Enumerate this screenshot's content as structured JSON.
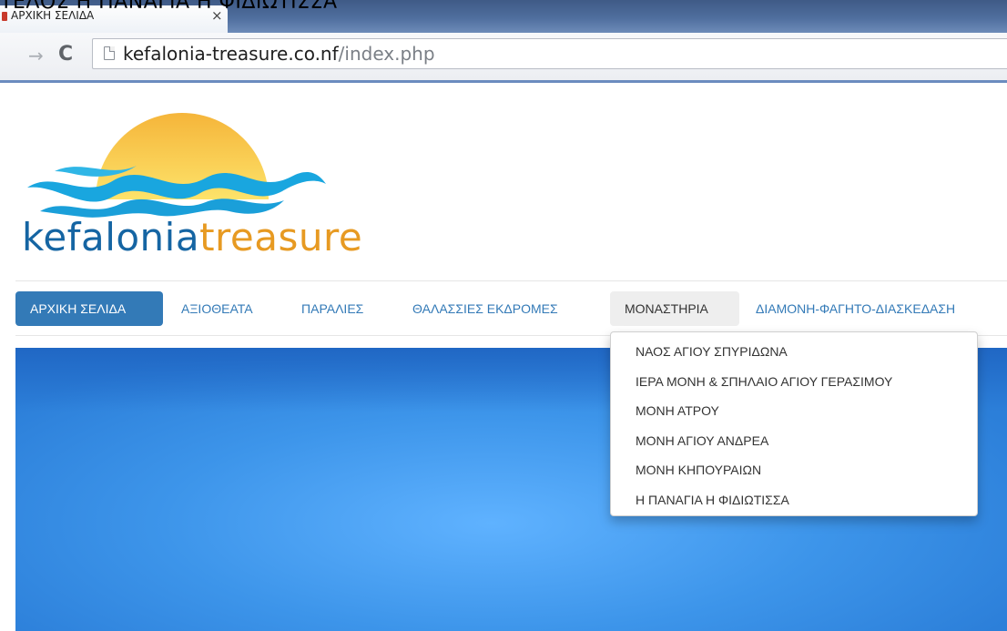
{
  "browser": {
    "stray_text": "ΤΕΛΟΣ Η ΠΑΝΑΓΙΑ Η ΦΙΔΙΩΤΙΣΣΑ",
    "tab_title": "ΑΡΧΙΚΗ ΣΕΛΙΔΑ",
    "tab_close_glyph": "×",
    "forward_glyph": "→",
    "reload_glyph": "C",
    "url_host": "kefalonia-treasure.co.nf",
    "url_path": "/index.php",
    "favicon_color": "#c83a2c",
    "accent_color": "#4f6e9e"
  },
  "site": {
    "logo_word1": "kefalonia",
    "logo_word2": "treasure",
    "logo_colors": {
      "word1": "#1565a3",
      "word2": "#e79a22",
      "sun": "#f7c23a",
      "waves": "#19a6df"
    }
  },
  "nav": {
    "items": [
      {
        "label": "ΑΡΧΙΚΗ ΣΕΛΙΔΑ",
        "state": "active"
      },
      {
        "label": "ΑΞΙΟΘΕΑΤΑ",
        "state": "normal"
      },
      {
        "label": "ΠΑΡΑΛΙΕΣ",
        "state": "normal"
      },
      {
        "label": "ΘΑΛΑΣΣΙΕΣ ΕΚΔΡΟΜΕΣ",
        "state": "normal"
      },
      {
        "label": "ΜΟΝΑΣΤΗΡΙΑ",
        "state": "open"
      },
      {
        "label": "ΔΙΑΜΟΝΗ-ΦΑΓΗΤΟ-ΔΙΑΣΚΕΔΑΣΗ",
        "state": "normal"
      }
    ],
    "active_color": "#337ab7"
  },
  "dropdown": {
    "items": [
      "ΝΑΟΣ ΑΓΙΟΥ ΣΠΥΡΙΔΩΝΑ",
      "ΙΕΡΑ ΜΟΝΗ & ΣΠΗΛΑΙΟ ΑΓΙΟΥ ΓΕΡΑΣΙΜΟΥ",
      "ΜΟΝΗ ΑΤΡΟΥ",
      "ΜΟΝΗ ΑΓΙΟΥ ΑΝΔΡΕΑ",
      "ΜΟΝΗ ΚΗΠΟΥΡΑΙΩΝ",
      "Η ΠΑΝΑΓΙΑ Η ΦΙΔΙΩΤΙΣΣΑ"
    ]
  },
  "hero": {
    "sky_color": "#3d95ea"
  }
}
